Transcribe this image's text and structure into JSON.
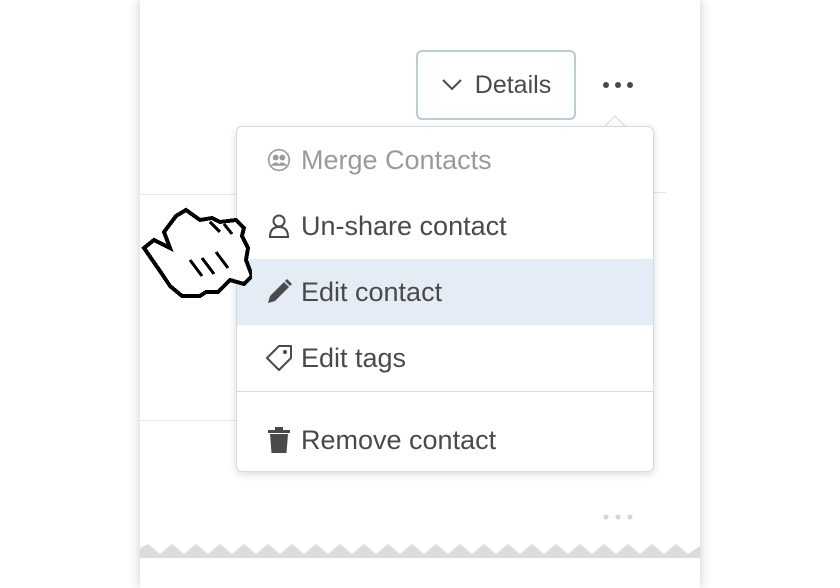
{
  "header": {
    "details_label": "Details"
  },
  "menu": {
    "items": [
      {
        "label": "Merge Contacts",
        "icon": "merge-contacts-icon",
        "state": "disabled"
      },
      {
        "label": "Un-share contact",
        "icon": "user-outline-icon",
        "state": "normal"
      },
      {
        "label": "Edit contact",
        "icon": "pencil-icon",
        "state": "hovered"
      },
      {
        "label": "Edit tags",
        "icon": "tag-icon",
        "state": "normal"
      },
      {
        "label": "Remove contact",
        "icon": "trash-icon",
        "state": "normal"
      }
    ]
  },
  "colors": {
    "text": "#4a4a4a",
    "disabled_text": "#9a9a9a",
    "hover_bg": "#e4ecf5",
    "button_border": "#b9cdd3",
    "divider": "#d5dadf"
  },
  "cursor": {
    "type": "pointing-hand-icon"
  }
}
